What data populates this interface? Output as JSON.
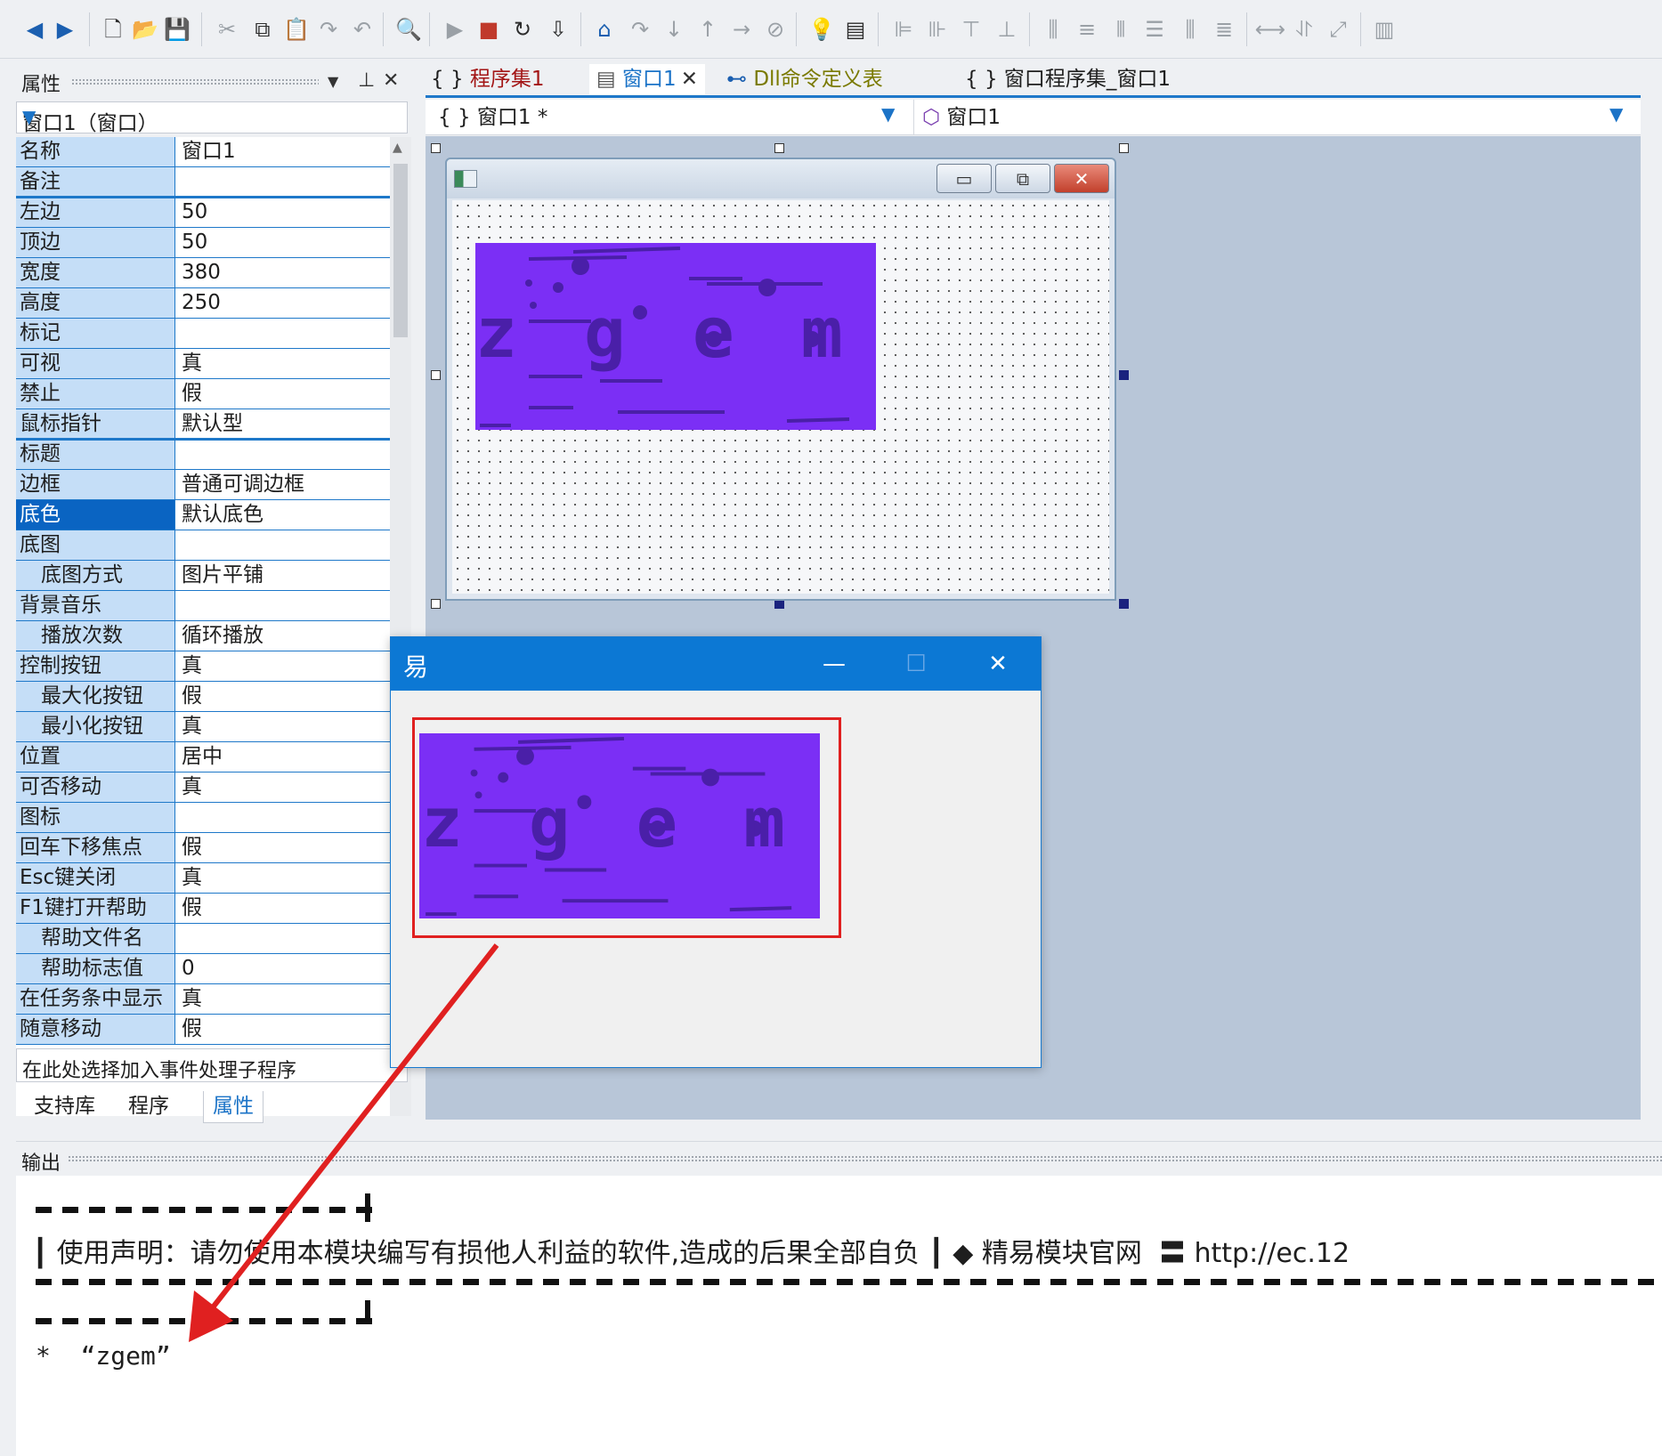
{
  "toolbar": {
    "icons": [
      "back-icon",
      "forward-icon",
      "new-file-icon",
      "open-folder-icon",
      "save-icon",
      "cut-icon",
      "copy-icon",
      "paste-icon",
      "redo-icon",
      "undo-icon",
      "find-icon",
      "run-icon",
      "stop-icon",
      "restart-icon",
      "compile-icon",
      "breakpoint-icon",
      "step-over-icon",
      "step-into-icon",
      "step-out-icon",
      "run-to-cursor-icon",
      "watch-icon",
      "hint-bulb-icon",
      "debug-window-icon",
      "align-left-icon",
      "align-right-icon",
      "align-top-icon",
      "align-bottom-icon",
      "center-horizontal-icon",
      "center-vertical-icon",
      "same-width-icon",
      "same-height-icon",
      "distribute-h-icon",
      "distribute-v-icon",
      "space-equal-icon",
      "height-equal-icon",
      "size-fit-icon",
      "layout-icon"
    ]
  },
  "properties_panel": {
    "title": "属性",
    "object_combo": "窗口1（窗口）",
    "rows": [
      {
        "name": "名称",
        "value": "窗口1",
        "indent": false
      },
      {
        "name": "备注",
        "value": "",
        "indent": false
      },
      {
        "name": "左边",
        "value": "50",
        "indent": false
      },
      {
        "name": "顶边",
        "value": "50",
        "indent": false
      },
      {
        "name": "宽度",
        "value": "380",
        "indent": false
      },
      {
        "name": "高度",
        "value": "250",
        "indent": false
      },
      {
        "name": "标记",
        "value": "",
        "indent": false
      },
      {
        "name": "可视",
        "value": "真",
        "indent": false
      },
      {
        "name": "禁止",
        "value": "假",
        "indent": false
      },
      {
        "name": "鼠标指针",
        "value": "默认型",
        "indent": false
      },
      {
        "name": "标题",
        "value": "",
        "indent": false
      },
      {
        "name": "边框",
        "value": "普通可调边框",
        "indent": false
      },
      {
        "name": "底色",
        "value": "默认底色",
        "indent": false,
        "selected": true
      },
      {
        "name": "底图",
        "value": "",
        "indent": false
      },
      {
        "name": "底图方式",
        "value": "图片平铺",
        "indent": true
      },
      {
        "name": "背景音乐",
        "value": "",
        "indent": false
      },
      {
        "name": "播放次数",
        "value": "循环播放",
        "indent": true
      },
      {
        "name": "控制按钮",
        "value": "真",
        "indent": false
      },
      {
        "name": "最大化按钮",
        "value": "假",
        "indent": true
      },
      {
        "name": "最小化按钮",
        "value": "真",
        "indent": true
      },
      {
        "name": "位置",
        "value": "居中",
        "indent": false
      },
      {
        "name": "可否移动",
        "value": "真",
        "indent": false
      },
      {
        "name": "图标",
        "value": "",
        "indent": false
      },
      {
        "name": "回车下移焦点",
        "value": "假",
        "indent": false
      },
      {
        "name": "Esc键关闭",
        "value": "真",
        "indent": false
      },
      {
        "name": "F1键打开帮助",
        "value": "假",
        "indent": false
      },
      {
        "name": "帮助文件名",
        "value": "",
        "indent": true
      },
      {
        "name": "帮助标志值",
        "value": "0",
        "indent": true
      },
      {
        "name": "在任务条中显示",
        "value": "真",
        "indent": false
      },
      {
        "name": "随意移动",
        "value": "假",
        "indent": false
      }
    ],
    "event_combo": "在此处选择加入事件处理子程序",
    "bottom_tabs": [
      "支持库",
      "程序",
      "属性"
    ],
    "active_bottom_tab": "属性"
  },
  "editor": {
    "tabs": [
      {
        "label": "程序集1",
        "icon": "{}",
        "color": "#a31515"
      },
      {
        "label": "窗口1",
        "icon": "window-icon",
        "color": "#1b73c7",
        "active": true
      },
      {
        "label": "Dll命令定义表",
        "icon": "link-icon",
        "color": "#7a7a00"
      },
      {
        "label": "窗口程序集_窗口1",
        "icon": "{}",
        "color": "#1e1e1e"
      }
    ],
    "nav_left": "窗口1 *",
    "nav_right": "窗口1"
  },
  "captcha_text": "z g e m",
  "preview_window": {
    "icon": "易",
    "minimize": "—",
    "maximize": "☐",
    "close": "✕"
  },
  "output": {
    "title": "输出",
    "notice": "┃ 使用声明：请勿使用本模块编写有损他人利益的软件,造成的后果全部自负 ┃ ◆ 精易模块官网  〓 http://ec.12",
    "result": "*  “zgem”"
  },
  "colors": {
    "accent": "#1e78c9",
    "captcha_bg": "#7b2ff5",
    "captcha_fg": "#4a1fa8",
    "highlight_box": "#e02020",
    "arrow": "#e02020"
  }
}
